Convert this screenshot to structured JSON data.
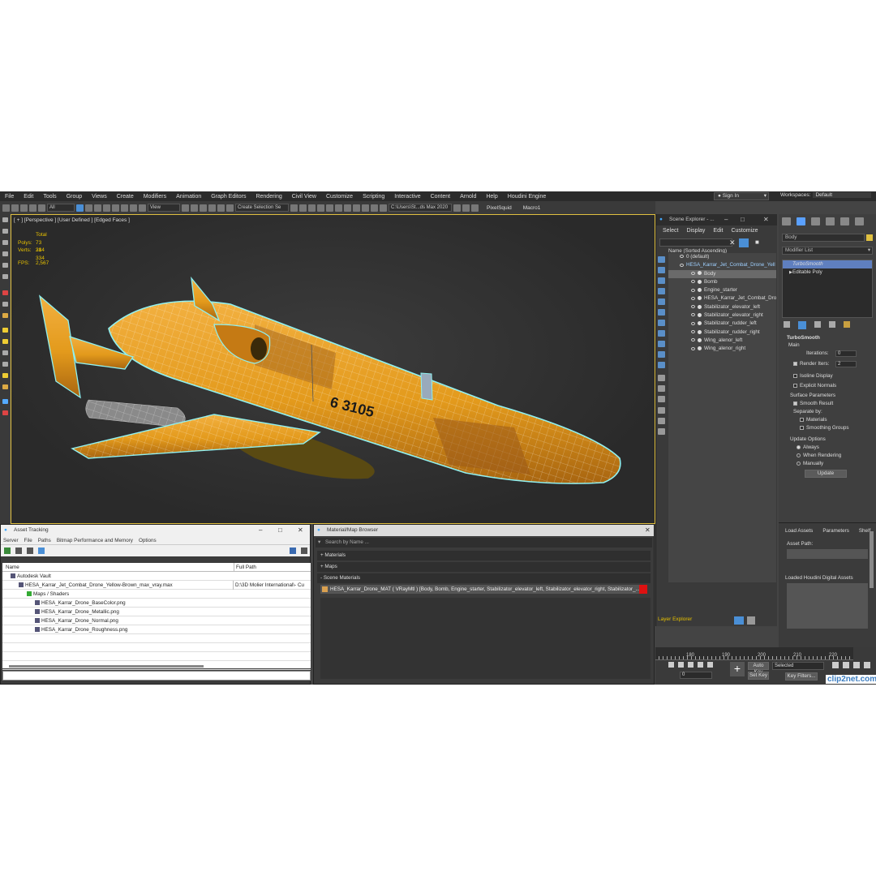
{
  "menubar": {
    "items": [
      "File",
      "Edit",
      "Tools",
      "Group",
      "Views",
      "Create",
      "Modifiers",
      "Animation",
      "Graph Editors",
      "Rendering",
      "Civil View",
      "Customize",
      "Scripting",
      "Interactive",
      "Content",
      "Arnold",
      "Help",
      "Houdini Engine"
    ],
    "sign_in": "Sign In",
    "workspaces_label": "Workspaces:",
    "workspaces_value": "Default"
  },
  "toolbar": {
    "filter": "All",
    "ref_coord": "View",
    "selection_set": "Create Selection Se",
    "path": "C:\\Users\\St...ds Max 2020",
    "pixelsquid": "PixelSquid",
    "macro": "Macro1"
  },
  "viewport": {
    "label": "[ + ] [Perspective ] [User Defined ] [Edged Faces ]",
    "stats_total": "Total",
    "polys_label": "Polys:",
    "polys": "73 214",
    "verts_label": "Verts:",
    "verts": "38 334",
    "fps_label": "FPS:",
    "fps": "2,567",
    "tail_marking": "6 3105",
    "colors": {
      "body": "#e39a1c",
      "stripe": "#9a5a1a",
      "outline": "#8ff0f0"
    }
  },
  "scene_explorer": {
    "title": "Scene Explorer - ...",
    "menu": [
      "Select",
      "Display",
      "Edit",
      "Customize"
    ],
    "column_header": "Name (Sorted Ascending)",
    "items": [
      {
        "label": "0 (default)",
        "indent": 1
      },
      {
        "label": "HESA_Karrar_Jet_Combat_Drone_Yell",
        "indent": 1,
        "highlight": true
      },
      {
        "label": "Body",
        "indent": 2,
        "selected": true
      },
      {
        "label": "Bomb",
        "indent": 2
      },
      {
        "label": "Engine_starter",
        "indent": 2
      },
      {
        "label": "HESA_Karrar_Jet_Combat_Drone_",
        "indent": 2
      },
      {
        "label": "Stabilizator_elevator_left",
        "indent": 2
      },
      {
        "label": "Stabilizator_elevator_right",
        "indent": 2
      },
      {
        "label": "Stabilizator_rudder_left",
        "indent": 2
      },
      {
        "label": "Stabilizator_rudder_right",
        "indent": 2
      },
      {
        "label": "Wing_alenor_left",
        "indent": 2
      },
      {
        "label": "Wing_alenor_right",
        "indent": 2
      }
    ],
    "layer_explorer": "Layer Explorer"
  },
  "command_panel": {
    "object_name": "Body",
    "modifier_list": "Modifier List",
    "stack": [
      "TurboSmooth",
      "Editable Poly"
    ],
    "turbosmooth": {
      "title": "TurboSmooth",
      "main": "Main",
      "iterations_label": "Iterations:",
      "iterations": "0",
      "render_iters_label": "Render Iters:",
      "render_iters": "2",
      "isoline": "Isoline Display",
      "explicit": "Explicit Normals",
      "surface_params": "Surface Parameters",
      "smooth_result": "Smooth Result",
      "separate_by": "Separate by:",
      "materials": "Materials",
      "smoothing_groups": "Smoothing Groups",
      "update_options": "Update Options",
      "always": "Always",
      "when_rendering": "When Rendering",
      "manually": "Manually",
      "update": "Update"
    }
  },
  "houdini": {
    "tabs": [
      "Load Assets",
      "Parameters",
      "Shelf"
    ],
    "asset_path": "Asset Path:",
    "loaded": "Loaded Houdini Digital Assets"
  },
  "asset_tracking": {
    "title": "Asset Tracking",
    "menu": [
      "Server",
      "File",
      "Paths",
      "Bitmap Performance and Memory",
      "Options"
    ],
    "col_name": "Name",
    "col_path": "Full Path",
    "rows": [
      {
        "name": "Autodesk Vault",
        "path": "",
        "indent": 1
      },
      {
        "name": "HESA_Karrar_Jet_Combat_Drone_Yellow-Brown_max_vray.max",
        "path": "D:\\3D Molier International\\- Cu",
        "indent": 2
      },
      {
        "name": "Maps / Shaders",
        "path": "",
        "indent": 3
      },
      {
        "name": "HESA_Karrar_Drone_BaseColor.png",
        "path": "",
        "indent": 4
      },
      {
        "name": "HESA_Karrar_Drone_Metallic.png",
        "path": "",
        "indent": 4
      },
      {
        "name": "HESA_Karrar_Drone_Normal.png",
        "path": "",
        "indent": 4
      },
      {
        "name": "HESA_Karrar_Drone_Roughness.png",
        "path": "",
        "indent": 4
      }
    ]
  },
  "material_browser": {
    "title": "Material/Map Browser",
    "search_placeholder": "Search by Name ...",
    "sections": [
      "+ Materials",
      "+ Maps",
      "- Scene Materials"
    ],
    "scene_material": "HESA_Karrar_Drone_MAT ( VRayMtl ) [Body, Bomb, Engine_starter, Stabilizator_elevator_left, Stabilizator_elevator_right, Stabilizator_..."
  },
  "timeline": {
    "ruler": [
      "180",
      "190",
      "200",
      "210",
      "220"
    ],
    "frame": "0",
    "auto_key": "Auto Key",
    "set_key": "Set Key",
    "selected": "Selected",
    "key_filters": "Key Filters..."
  },
  "watermark": "clip2net.com"
}
